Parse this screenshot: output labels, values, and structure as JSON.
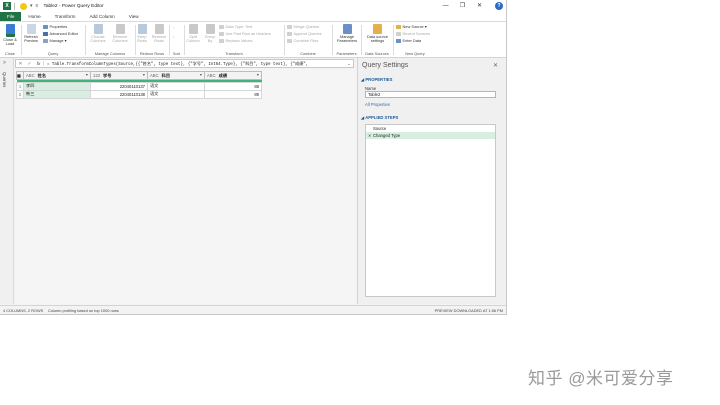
{
  "window": {
    "title": "Table2 - Power Query Editor",
    "controls": {
      "minimize": "—",
      "restore": "❐",
      "close": "✕"
    },
    "help": "?"
  },
  "tabs": [
    "File",
    "Home",
    "Transform",
    "Add Column",
    "View"
  ],
  "ribbon": {
    "close": {
      "button": "Close & Load",
      "label": "Close",
      "icon": "close-load-icon"
    },
    "query": {
      "refresh": "Refresh Preview",
      "properties": "Properties",
      "advanced_editor": "Advanced Editor",
      "manage": "Manage",
      "label": "Query"
    },
    "manage_columns": {
      "choose": "Choose Columns",
      "remove": "Remove Columns",
      "label": "Manage Columns"
    },
    "reduce_rows": {
      "keep": "Keep Rows",
      "remove": "Remove Rows",
      "label": "Reduce Rows"
    },
    "sort": {
      "label": "Sort"
    },
    "transform": {
      "split": "Split Column",
      "group": "Group By",
      "data_type": "Data Type: Text",
      "first_row": "Use First Row as Headers",
      "replace": "Replace Values",
      "label": "Transform"
    },
    "combine": {
      "merge": "Merge Queries",
      "append": "Append Queries",
      "combine_files": "Combine Files",
      "label": "Combine"
    },
    "parameters": {
      "manage": "Manage Parameters",
      "label": "Parameters"
    },
    "data_sources": {
      "settings": "Data source settings",
      "label": "Data Sources"
    },
    "new_query": {
      "new_source": "New Source",
      "recent": "Recent Sources",
      "enter_data": "Enter Data",
      "label": "New Query"
    }
  },
  "queries_rail": {
    "label": "Queries",
    "caret": ">"
  },
  "formula_bar": {
    "cancel": "✕",
    "commit": "✓",
    "fx": "fx",
    "formula": "= Table.TransformColumnTypes(Source,{{\"姓名\", type text}, {\"学号\", Int64.Type}, {\"科目\", type text}, {\"成绩\",",
    "expand": "⌄"
  },
  "grid": {
    "columns": [
      {
        "name": "姓名",
        "type_icon": "ABC"
      },
      {
        "name": "学号",
        "type_icon": "123"
      },
      {
        "name": "科目",
        "type_icon": "ABC"
      },
      {
        "name": "成绩",
        "type_icon": "ABC"
      }
    ],
    "rows": [
      {
        "n": "1",
        "cells": [
          "李四",
          "22040110137",
          "语文",
          "88"
        ]
      },
      {
        "n": "2",
        "cells": [
          "韩三",
          "22040110138",
          "语文",
          "89"
        ]
      }
    ]
  },
  "query_settings": {
    "title": "Query Settings",
    "close": "✕",
    "properties_header": "PROPERTIES",
    "name_label": "Name",
    "name_value": "Table2",
    "all_properties": "All Properties",
    "steps_header": "APPLIED STEPS",
    "steps": [
      "Source",
      "Changed Type"
    ]
  },
  "status_bar": {
    "columns_rows": "4 COLUMNS, 2 ROWS",
    "profiling": "Column profiling based on top 1000 rows",
    "preview": "PREVIEW DOWNLOADED AT 1:56 PM"
  },
  "watermark": "知乎 @米可爱分享",
  "colors": {
    "accent": "#217346",
    "quality_bar": "#3fb47d",
    "selection": "#d7eee0",
    "link": "#2a6ebb"
  }
}
